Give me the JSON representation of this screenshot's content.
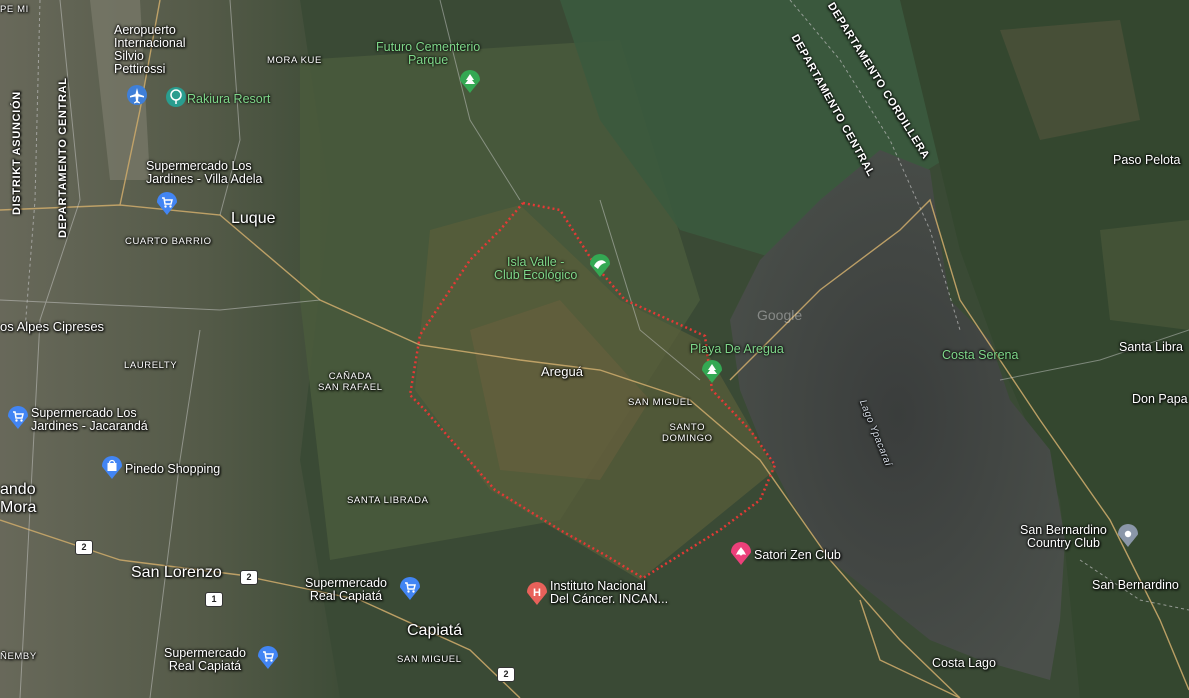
{
  "map": {
    "watermark": "Google",
    "boundary_color": "#e53935",
    "labels": {
      "airport": [
        "Aeropuerto",
        "Internacional",
        "Silvio",
        "Pettirossi"
      ],
      "rakiura": "Rakiura Resort",
      "futuro": [
        "Futuro Cementerio",
        "Parque"
      ],
      "mora_kue": "MORA KUE",
      "district_asuncion": "DISTRIKT ASUNCIÓN",
      "dept_central_left": "DEPARTAMENTO CENTRAL",
      "dept_central_right": "DEPARTAMENTO CENTRAL",
      "dept_cordillera": "DEPARTAMENTO CORDILLERA",
      "super_adela": [
        "Supermercado Los",
        "Jardines - Villa Adela"
      ],
      "luque": "Luque",
      "cuarto_barrio": "CUARTO BARRIO",
      "isla_valle": [
        "Isla Valle -",
        "Club Ecológico"
      ],
      "alpes": "os Alpes Cipreses",
      "laurelty": "LAURELTY",
      "canada": [
        "CAÑADA",
        "SAN RAFAEL"
      ],
      "aregua": "Areguá",
      "playa": "Playa De Aregua",
      "san_miguel": "SAN MIGUEL",
      "santo_domingo": [
        "SANTO",
        "DOMINGO"
      ],
      "lago": "Lago Ypacaraí",
      "costa_serena": "Costa Serena",
      "paso_pelota": "Paso Pelota",
      "santa_libra": "Santa Libra",
      "don_papa": "Don Papa",
      "super_jacaranda": [
        "Supermercado Los",
        "Jardines - Jacarandá"
      ],
      "pinedo": "Pinedo Shopping",
      "ndo_mora": [
        "ando",
        "Mora"
      ],
      "santa_librada": "SANTA LIBRADA",
      "san_lorenzo": "San Lorenzo",
      "super_capiata_1": [
        "Supermercado",
        "Real Capiatá"
      ],
      "instituto": [
        "Instituto Nacional",
        "Del Cáncer. INCAN..."
      ],
      "satori": "Satori Zen Club",
      "san_bernardino_cc": [
        "San Bernardino",
        "Country Club"
      ],
      "san_bernardino": "San Bernardino",
      "capiata": "Capiatá",
      "super_capiata_2": [
        "Supermercado",
        "Real Capiatá"
      ],
      "nemby": "ÑEMBY",
      "san_miguel_2": "SAN MIGUEL",
      "costa_lago": "Costa Lago"
    },
    "route_shields": [
      "2",
      "2",
      "1",
      "2"
    ],
    "icons": {
      "airport": "airplane-icon",
      "rakiura": "resort-icon",
      "futuro": "park-icon",
      "super_adela": "shopping-cart-icon",
      "isla_valle": "nature-club-icon",
      "playa": "park-icon",
      "super_jacaranda": "shopping-cart-icon",
      "pinedo": "shopping-bag-icon",
      "super_capiata_1": "shopping-cart-icon",
      "instituto": "hospital-icon",
      "satori": "spa-icon",
      "san_bernardino_cc": "place-icon",
      "super_capiata_2": "shopping-cart-icon"
    }
  }
}
